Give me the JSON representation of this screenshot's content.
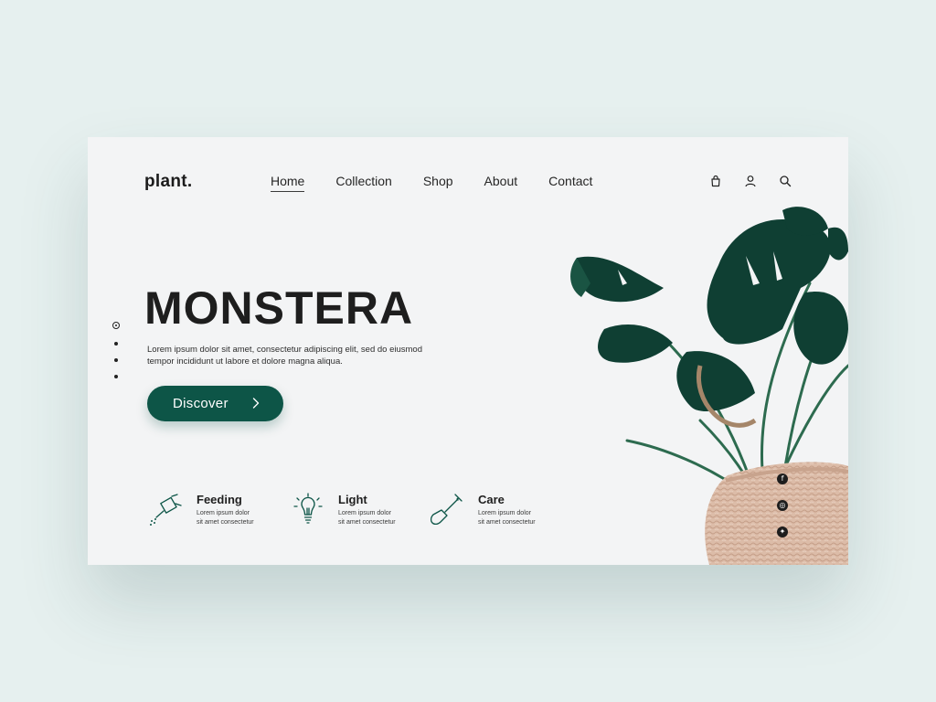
{
  "brand": {
    "logo": "plant."
  },
  "nav": {
    "items": [
      "Home",
      "Collection",
      "Shop",
      "About",
      "Contact"
    ],
    "active": "Home"
  },
  "top_icons": [
    "bag-icon",
    "user-icon",
    "search-icon"
  ],
  "hero": {
    "title": "MONSTERA",
    "description_line1": "Lorem ipsum dolor sit amet, consectetur adipiscing elit, sed do eiusmod",
    "description_line2": "tempor incididunt ut labore et dolore magna aliqua.",
    "cta": "Discover",
    "slide_count": 4,
    "active_slide": 1
  },
  "features": [
    {
      "title": "Feeding",
      "text1": "Lorem ipsum dolor",
      "text2": "sit amet consectetur",
      "icon": "watering-can-icon"
    },
    {
      "title": "Light",
      "text1": "Lorem ipsum dolor",
      "text2": "sit amet consectetur",
      "icon": "lightbulb-icon"
    },
    {
      "title": "Care",
      "text1": "Lorem ipsum dolor",
      "text2": "sit amet consectetur",
      "icon": "shovel-icon"
    }
  ],
  "socials": [
    {
      "icon": "facebook-icon",
      "glyph": "f"
    },
    {
      "icon": "instagram-icon",
      "glyph": "◎"
    },
    {
      "icon": "twitter-icon",
      "glyph": "✦"
    }
  ],
  "colors": {
    "accent": "#0d5547",
    "background": "#e6f0ef",
    "card": "#f3f4f5",
    "leaf": "#0f3f33",
    "basket": "#d8b7a2"
  }
}
